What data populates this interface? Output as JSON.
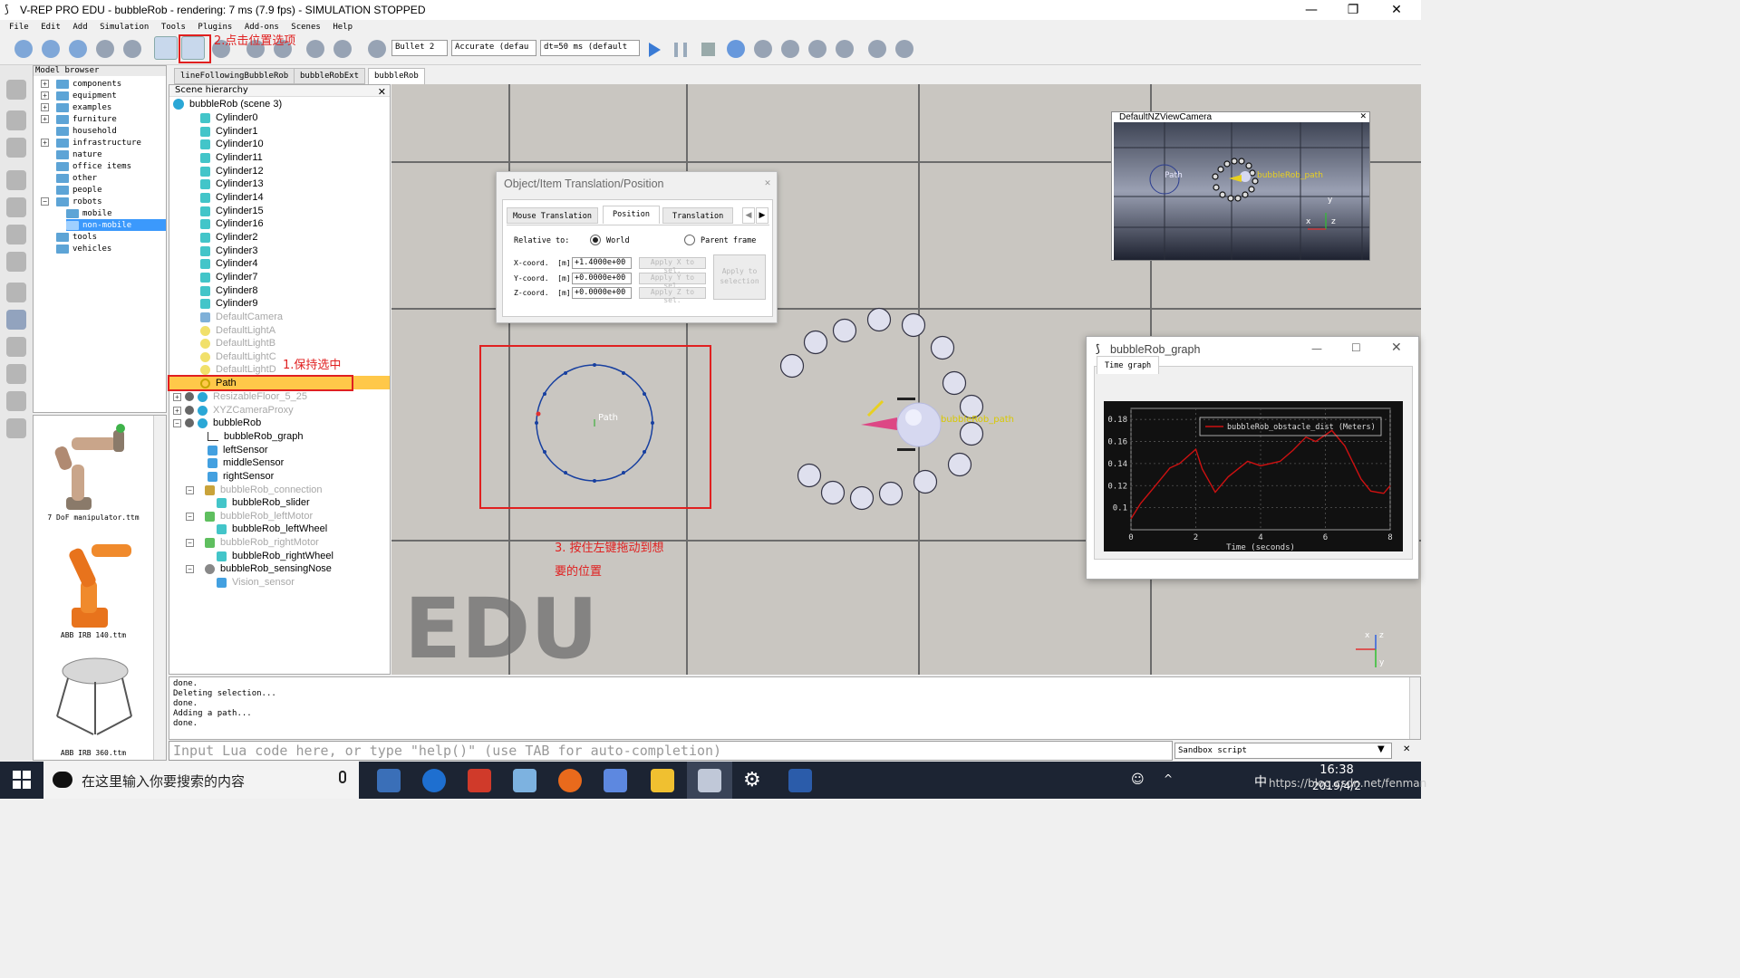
{
  "window": {
    "title": "V-REP PRO EDU - bubbleRob - rendering: 7 ms (7.9 fps) - SIMULATION STOPPED",
    "minimize": "—",
    "maximize": "❐",
    "close": "✕"
  },
  "menu": [
    "File",
    "Edit",
    "Add",
    "Simulation",
    "Tools",
    "Plugins",
    "Add-ons",
    "Scenes",
    "Help"
  ],
  "toolbar": {
    "engine": "Bullet 2",
    "accuracy": "Accurate (defau",
    "timestep": "dt=50 ms (default"
  },
  "model_browser": {
    "header": "Model browser",
    "folders": [
      "components",
      "equipment",
      "examples",
      "furniture",
      "household",
      "infrastructure",
      "nature",
      "office items",
      "other",
      "people",
      "robots",
      "mobile",
      "non-mobile",
      "tools",
      "vehicles"
    ],
    "thumbnails": [
      "7 DoF manipulator.ttm",
      "ABB IRB 140.ttm",
      "ABB IRB 360.ttm"
    ]
  },
  "scene_tabs": [
    "lineFollowingBubbleRob",
    "bubbleRobExt",
    "bubbleRob"
  ],
  "hierarchy": {
    "header": "Scene hierarchy",
    "root": "bubbleRob (scene 3)",
    "cylinders": [
      "Cylinder0",
      "Cylinder1",
      "Cylinder10",
      "Cylinder11",
      "Cylinder12",
      "Cylinder13",
      "Cylinder14",
      "Cylinder15",
      "Cylinder16",
      "Cylinder2",
      "Cylinder3",
      "Cylinder4",
      "Cylinder7",
      "Cylinder8",
      "Cylinder9"
    ],
    "lights": [
      "DefaultCamera",
      "DefaultLightA",
      "DefaultLightB",
      "DefaultLightC",
      "DefaultLightD"
    ],
    "path": "Path",
    "floor": "ResizableFloor_5_25",
    "camproxy": "XYZCameraProxy",
    "robot": "bubbleRob",
    "robot_children": [
      "bubbleRob_graph",
      "leftSensor",
      "middleSensor",
      "rightSensor"
    ],
    "connection": "bubbleRob_connection",
    "slider": "bubbleRob_slider",
    "leftMotor": "bubbleRob_leftMotor",
    "leftWheel": "bubbleRob_leftWheel",
    "rightMotor": "bubbleRob_rightMotor",
    "rightWheel": "bubbleRob_rightWheel",
    "sensingNose": "bubbleRob_sensingNose",
    "vision": "Vision_sensor"
  },
  "annotations": {
    "a1": "1.保持选中",
    "a2": "2.点击位置选项",
    "a3_line1": "3. 按住左键拖动到想",
    "a3_line2": "要的位置"
  },
  "position_dialog": {
    "title": "Object/Item Translation/Position",
    "tabs": [
      "Mouse Translation",
      "Position",
      "Translation"
    ],
    "relative_to": "Relative to:",
    "world": "World",
    "parent": "Parent frame",
    "x_label": "X-coord.  [m]",
    "y_label": "Y-coord.  [m]",
    "z_label": "Z-coord.  [m]",
    "x_val": "+1.4000e+00",
    "y_val": "+0.0000e+00",
    "z_val": "+0.0000e+00",
    "apply_x": "Apply X to sel.",
    "apply_y": "Apply Y to sel.",
    "apply_z": "Apply Z to sel.",
    "apply_sel": "Apply to selection"
  },
  "viewport": {
    "watermark": "EDU",
    "path_label": "Path",
    "robot_path_label": "bubbleRob_path",
    "axis_x": "x",
    "axis_y": "y",
    "axis_z": "z"
  },
  "camera_view": {
    "title": "DefaultNZViewCamera",
    "path_label": "Path",
    "robot_path_label": "bubbleRob_path",
    "axis_x": "x",
    "axis_y": "y",
    "axis_z": "z"
  },
  "graph_window": {
    "title": "bubbleRob_graph",
    "tab": "Time graph",
    "legend": "bubbleRob_obstacle_dist (Meters)",
    "xlabel": "Time (seconds)",
    "yticks": [
      "0.18",
      "0.16",
      "0.14",
      "0.12",
      "0.1"
    ],
    "xticks": [
      "0",
      "2",
      "4",
      "6",
      "8"
    ]
  },
  "chart_data": {
    "type": "line",
    "series": [
      {
        "name": "bubbleRob_obstacle_dist (Meters)",
        "x": [
          0,
          0.3,
          0.7,
          1.2,
          1.5,
          2.0,
          2.2,
          2.6,
          3.0,
          3.6,
          4.0,
          4.6,
          5.0,
          5.4,
          5.7,
          6.2,
          6.6,
          7.1,
          7.4,
          7.8,
          8.0
        ],
        "y": [
          0.09,
          0.104,
          0.118,
          0.136,
          0.14,
          0.153,
          0.135,
          0.114,
          0.128,
          0.142,
          0.138,
          0.142,
          0.152,
          0.164,
          0.16,
          0.17,
          0.156,
          0.126,
          0.115,
          0.113,
          0.12
        ]
      }
    ],
    "xlabel": "Time (seconds)",
    "xlim": [
      0,
      8
    ],
    "ylim": [
      0.08,
      0.19
    ],
    "grid": true,
    "legend": "top-right",
    "colors": {
      "line": "#cc1111",
      "background": "#111111"
    }
  },
  "console": {
    "lines": [
      "done.",
      "Deleting selection...",
      "done.",
      "Adding a path...",
      "done."
    ]
  },
  "lua": {
    "placeholder": "Input Lua code here, or type \"help()\" (use TAB for auto-completion)",
    "sandbox": "Sandbox script"
  },
  "taskbar": {
    "search": "在这里输入你要搜索的内容",
    "time": "16:38",
    "date": "2019/4/2",
    "watermark": "https://blog.csdn.net/fenman",
    "ime": "中"
  },
  "colors": {
    "annotation_red": "#e02020",
    "selected_row": "#ffc849",
    "taskbar": "#1c2433"
  }
}
